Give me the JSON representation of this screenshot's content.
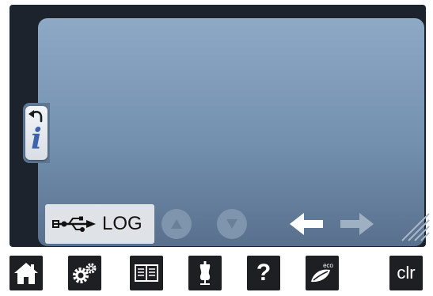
{
  "info_panel": {
    "undo_icon": "undo-arrow-icon",
    "info_icon": "info-i-icon",
    "info_glyph": "i"
  },
  "log_button": {
    "icon": "usb-icon",
    "label": "LOG"
  },
  "navigation": {
    "scroll_up_icon": "triangle-up-icon",
    "scroll_down_icon": "triangle-down-icon",
    "back_icon": "arrow-left-icon",
    "forward_icon": "arrow-right-icon"
  },
  "taskbar": {
    "home_icon": "home-icon",
    "setup_icon": "gears-icon",
    "tutorial_icon": "open-book-icon",
    "sewing_consultant_icon": "dress-form-icon",
    "help_label": "?",
    "eco_label": "eco",
    "eco_icon": "leaf-icon",
    "clr_label": "clr"
  },
  "colors": {
    "panel_top": "#8ea9c6",
    "panel_bottom": "#58708c",
    "taskbar_button": "#1e1f22",
    "info_glyph": "#3f62ad",
    "log_button_bg": "#dfe3e8"
  }
}
